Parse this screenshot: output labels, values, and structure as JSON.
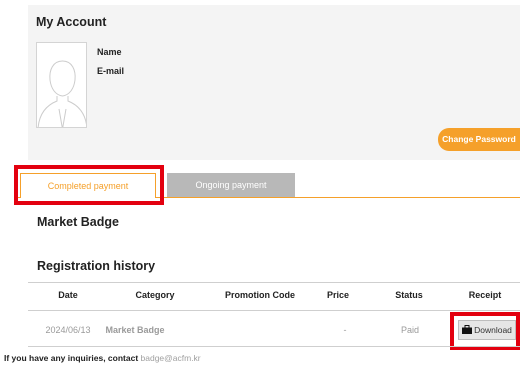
{
  "account": {
    "title": "My Account",
    "name_label": "Name",
    "email_label": "E-mail",
    "change_password_label": "Change Password"
  },
  "tabs": [
    {
      "label": "Completed payment",
      "active": true
    },
    {
      "label": "Ongoing payment",
      "active": false
    }
  ],
  "section_title": "Market Badge",
  "history_title": "Registration history",
  "table": {
    "headers": [
      "Date",
      "Category",
      "Promotion Code",
      "Price",
      "Status",
      "Receipt"
    ],
    "rows": [
      {
        "date": "2024/06/13",
        "category": "Market Badge",
        "promotion_code": "",
        "price": "-",
        "status": "Paid",
        "receipt_label": "Download"
      }
    ]
  },
  "contact": {
    "text": "If you have any inquiries, contact ",
    "email": "badge@acfm.kr"
  },
  "colors": {
    "accent": "#f5a02a",
    "highlight": "#e3000f",
    "tab_inactive": "#b8b8b8",
    "panel_bg": "#f4f4f4"
  }
}
